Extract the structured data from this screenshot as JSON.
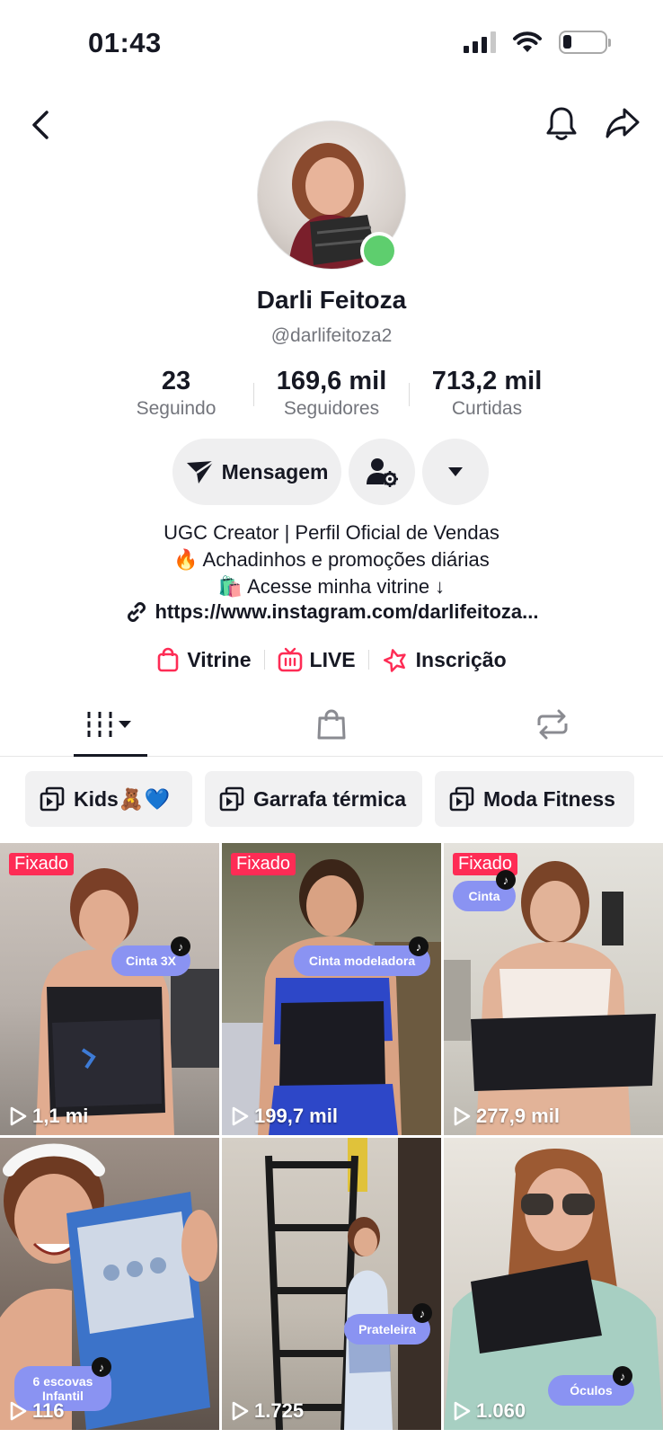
{
  "status_bar": {
    "time": "01:43"
  },
  "profile": {
    "display_name": "Darli Feitoza",
    "username": "@darlifeitoza2",
    "stats": [
      {
        "value": "23",
        "label": "Seguindo"
      },
      {
        "value": "169,6 mil",
        "label": "Seguidores"
      },
      {
        "value": "713,2 mil",
        "label": "Curtidas"
      }
    ],
    "message_button": "Mensagem",
    "bio_lines": [
      "UGC Creator | Perfil Oficial de Vendas",
      "🔥 Achadinhos e promoções diárias",
      "🛍️ Acesse minha vitrine ↓"
    ],
    "link": "https://www.instagram.com/darlifeitoza..."
  },
  "quick_links": [
    {
      "label": "Vitrine",
      "icon": "shopping-bag-icon"
    },
    {
      "label": "LIVE",
      "icon": "live-tv-icon"
    },
    {
      "label": "Inscrição",
      "icon": "star-badge-icon"
    }
  ],
  "tabs": [
    {
      "icon": "videos-grid-icon",
      "active": true
    },
    {
      "icon": "shopping-bag-icon",
      "active": false
    },
    {
      "icon": "repost-icon",
      "active": false
    }
  ],
  "playlists": [
    {
      "label": "Kids🧸💙"
    },
    {
      "label": "Garrafa térmica"
    },
    {
      "label": "Moda Fitness"
    }
  ],
  "videos": [
    {
      "pinned_label": "Fixado",
      "views": "1,1 mi",
      "sticker": "Cinta 3X"
    },
    {
      "pinned_label": "Fixado",
      "views": "199,7 mil",
      "sticker": "Cinta modeladora"
    },
    {
      "pinned_label": "Fixado",
      "views": "277,9 mil",
      "sticker": "Cinta"
    },
    {
      "pinned_label": "",
      "views": "116",
      "sticker": "6 escovas Infantil"
    },
    {
      "pinned_label": "",
      "views": "1.725",
      "sticker": "Prateleira"
    },
    {
      "pinned_label": "",
      "views": "1.060",
      "sticker": "Óculos"
    }
  ],
  "colors": {
    "accent": "#fe2c55",
    "online": "#5ece6e",
    "sticker": "#8a93f2"
  }
}
